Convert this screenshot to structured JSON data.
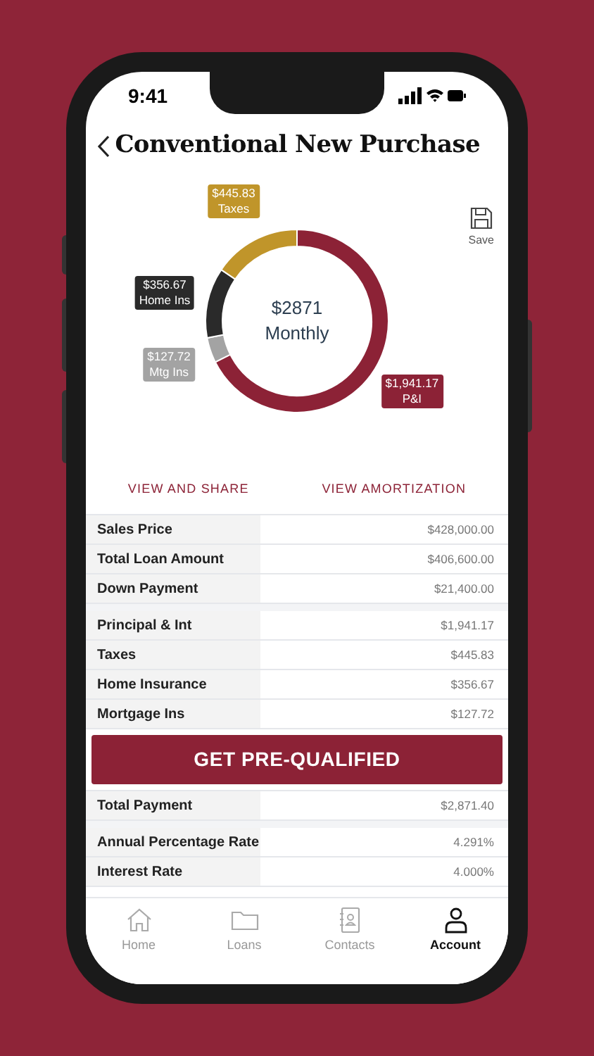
{
  "status_bar": {
    "time": "9:41"
  },
  "header": {
    "title": "Conventional New Purchase"
  },
  "save_button": {
    "label": "Save"
  },
  "payment_chart": {
    "center_amount": "$2871",
    "chart_data": {
      "type": "donut",
      "categories": [
        "P&I",
        "Mtg Ins",
        "Home Ins",
        "Taxes"
      ],
      "series": [
        {
          "name": "Monthly",
          "values": [
            67.6,
            4.45,
            12.42,
            15.53
          ]
        }
      ],
      "colors": [
        "#8c2236",
        "#a3a3a3",
        "#2a2a2a",
        "#c0952a"
      ],
      "value_labels": [
        "$1,941.17",
        "$127.72",
        "$356.67",
        "$445.83"
      ]
    }
  },
  "links": [
    {
      "label": "VIEW AND SHARE"
    },
    {
      "label": "VIEW AMORTIZATION"
    }
  ],
  "loan_summary": [
    [
      {
        "label": "Sales Price",
        "value": "$428,000.00"
      },
      {
        "label": "Total Loan Amount",
        "value": "$406,600.00"
      },
      {
        "label": "Down Payment",
        "value": "$21,400.00"
      }
    ],
    [
      {
        "label": "Principal & Int",
        "value": "$1,941.17"
      },
      {
        "label": "Taxes",
        "value": "$445.83"
      },
      {
        "label": "Home Insurance",
        "value": "$356.67"
      },
      {
        "label": "Mortgage Ins",
        "value": "$127.72"
      }
    ]
  ],
  "pre_qualify_button": {
    "label": "GET PRE-QUALIFIED"
  },
  "payment_summary": [
    [
      {
        "label": "Total Payment",
        "value": "$2,871.40"
      }
    ],
    [
      {
        "label": "Annual Percentage Rate",
        "value": "4.291%"
      },
      {
        "label": "Interest Rate",
        "value": "4.000%"
      }
    ]
  ],
  "tab_bar": [
    {
      "label": "Home",
      "kind": "home",
      "selected": false
    },
    {
      "label": "Loans",
      "kind": "folder",
      "selected": false
    },
    {
      "label": "Contacts",
      "kind": "contacts",
      "selected": false
    },
    {
      "label": "Account",
      "kind": "person",
      "selected": true
    }
  ]
}
